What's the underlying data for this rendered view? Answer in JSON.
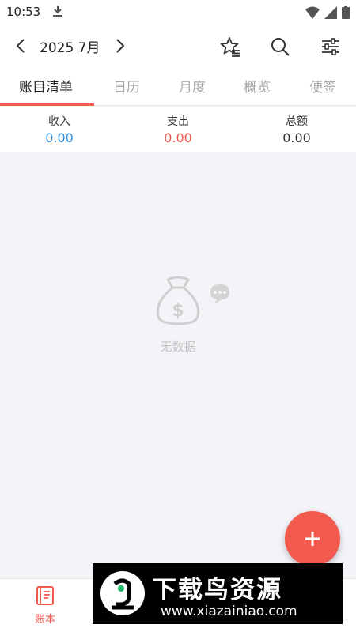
{
  "status_bar": {
    "time": "10:53"
  },
  "header": {
    "month": "2025 7月"
  },
  "tabs": [
    {
      "label": "账目清单",
      "active": true
    },
    {
      "label": "日历",
      "active": false
    },
    {
      "label": "月度",
      "active": false
    },
    {
      "label": "概览",
      "active": false
    },
    {
      "label": "便签",
      "active": false
    }
  ],
  "summary": {
    "income": {
      "label": "收入",
      "value": "0.00",
      "color": "#2f8fe0"
    },
    "expense": {
      "label": "支出",
      "value": "0.00",
      "color": "#f05a4f"
    },
    "total": {
      "label": "总额",
      "value": "0.00",
      "color": "#333333"
    }
  },
  "empty_state": {
    "text": "无数据",
    "icon": "money-bag-icon"
  },
  "bottom_nav": {
    "items": [
      {
        "label": "账本",
        "icon": "ledger-book-icon"
      }
    ]
  },
  "watermark": {
    "title": "下载鸟资源",
    "url": "www.xiazainiao.com"
  },
  "colors": {
    "accent": "#f05a4f",
    "background": "#f4f3f8"
  }
}
